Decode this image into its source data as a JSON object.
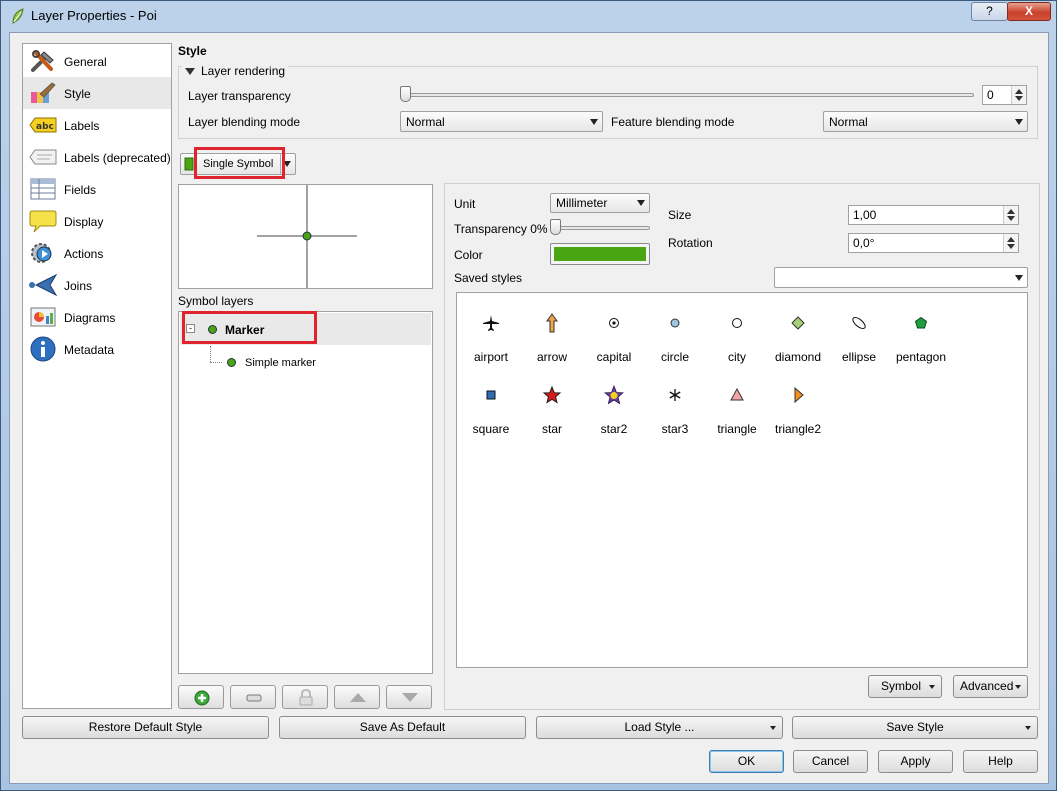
{
  "window": {
    "title": "Layer Properties - Poi",
    "help_button": "?",
    "close_button": "X"
  },
  "sidebar": {
    "items": [
      {
        "label": "General",
        "icon": "tools-icon"
      },
      {
        "label": "Style",
        "icon": "paintbrush-icon"
      },
      {
        "label": "Labels",
        "icon": "abc-label-icon"
      },
      {
        "label": "Labels (deprecated)",
        "icon": "label-tag-icon"
      },
      {
        "label": "Fields",
        "icon": "table-icon"
      },
      {
        "label": "Display",
        "icon": "speech-bubble-icon"
      },
      {
        "label": "Actions",
        "icon": "gear-play-icon"
      },
      {
        "label": "Joins",
        "icon": "join-arrow-icon"
      },
      {
        "label": "Diagrams",
        "icon": "chart-icon"
      },
      {
        "label": "Metadata",
        "icon": "info-icon"
      }
    ],
    "active": "Style",
    "abc_text": "abc"
  },
  "style": {
    "heading": "Style",
    "layer_rendering": {
      "title": "Layer rendering",
      "transparency_label": "Layer transparency",
      "transparency_value": "0",
      "layer_blending_label": "Layer blending mode",
      "layer_blending_value": "Normal",
      "feature_blending_label": "Feature blending mode",
      "feature_blending_value": "Normal"
    },
    "renderer": "Single Symbol",
    "symbol_layers_label": "Symbol layers",
    "tree": {
      "root": "Marker",
      "child": "Simple marker"
    },
    "properties": {
      "unit_label": "Unit",
      "unit_value": "Millimeter",
      "transparency_label": "Transparency 0%",
      "transparency_fraction": 0,
      "color_label": "Color",
      "color_value": "#4aa513",
      "size_label": "Size",
      "size_value": "1,00",
      "rotation_label": "Rotation",
      "rotation_value": "0,0°",
      "saved_styles_label": "Saved styles",
      "saved_styles_value": ""
    },
    "gallery": [
      {
        "label": "airport",
        "icon": "airplane-icon"
      },
      {
        "label": "arrow",
        "icon": "arrow-up-icon"
      },
      {
        "label": "capital",
        "icon": "capital-dot-icon"
      },
      {
        "label": "circle",
        "icon": "circle-icon"
      },
      {
        "label": "city",
        "icon": "city-circle-icon"
      },
      {
        "label": "diamond",
        "icon": "diamond-icon"
      },
      {
        "label": "ellipse",
        "icon": "ellipse-icon"
      },
      {
        "label": "pentagon",
        "icon": "pentagon-icon"
      },
      {
        "label": "square",
        "icon": "square-icon"
      },
      {
        "label": "star",
        "icon": "star-icon"
      },
      {
        "label": "star2",
        "icon": "star2-icon"
      },
      {
        "label": "star3",
        "icon": "asterisk-icon"
      },
      {
        "label": "triangle",
        "icon": "triangle-icon"
      },
      {
        "label": "triangle2",
        "icon": "triangle-right-icon"
      }
    ],
    "symbol_button": "Symbol",
    "advanced_button": "Advanced"
  },
  "footer": {
    "restore_default": "Restore Default Style",
    "save_as_default": "Save As Default",
    "load_style": "Load Style ...",
    "save_style": "Save Style",
    "ok": "OK",
    "cancel": "Cancel",
    "apply": "Apply",
    "help": "Help"
  },
  "colors": {
    "highlight_box": "#e0242f",
    "marker_green": "#4aa513",
    "window_frame": "#bcd2ea"
  }
}
